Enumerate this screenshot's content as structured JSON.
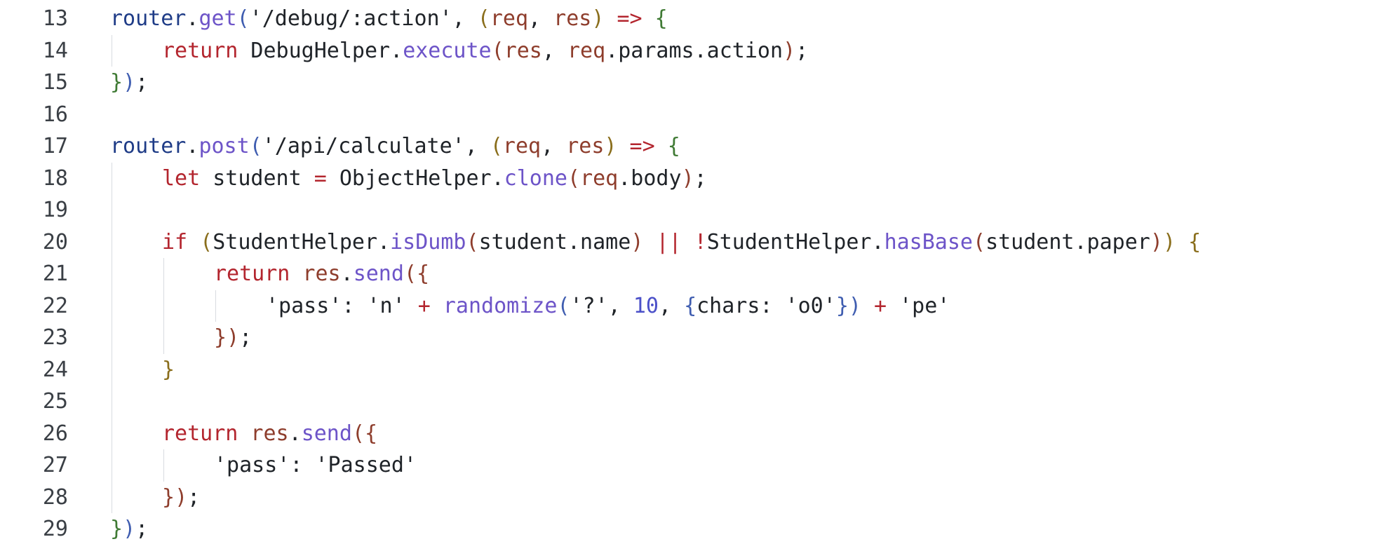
{
  "editor": {
    "lines": [
      {
        "number": "13",
        "indent": 0,
        "tokens": [
          {
            "t": "router",
            "c": "var"
          },
          {
            "t": ".",
            "c": "punc"
          },
          {
            "t": "get",
            "c": "fn"
          },
          {
            "t": "(",
            "c": "b3"
          },
          {
            "t": "'/debug/:action'",
            "c": "str"
          },
          {
            "t": ", ",
            "c": "punc"
          },
          {
            "t": "(",
            "c": "b4"
          },
          {
            "t": "req",
            "c": "param"
          },
          {
            "t": ", ",
            "c": "punc"
          },
          {
            "t": "res",
            "c": "param"
          },
          {
            "t": ")",
            "c": "b4"
          },
          {
            "t": " ",
            "c": "punc"
          },
          {
            "t": "=>",
            "c": "arrow"
          },
          {
            "t": " ",
            "c": "punc"
          },
          {
            "t": "{",
            "c": "b1"
          }
        ]
      },
      {
        "number": "14",
        "indent": 1,
        "tokens": [
          {
            "t": "return",
            "c": "kw"
          },
          {
            "t": " DebugHelper",
            "c": "id"
          },
          {
            "t": ".",
            "c": "punc"
          },
          {
            "t": "execute",
            "c": "fn"
          },
          {
            "t": "(",
            "c": "b2"
          },
          {
            "t": "res",
            "c": "param"
          },
          {
            "t": ", ",
            "c": "punc"
          },
          {
            "t": "req",
            "c": "param"
          },
          {
            "t": ".params.action",
            "c": "id"
          },
          {
            "t": ")",
            "c": "b2"
          },
          {
            "t": ";",
            "c": "punc"
          }
        ]
      },
      {
        "number": "15",
        "indent": 0,
        "tokens": [
          {
            "t": "}",
            "c": "b1"
          },
          {
            "t": ")",
            "c": "b3"
          },
          {
            "t": ";",
            "c": "punc"
          }
        ]
      },
      {
        "number": "16",
        "indent": 0,
        "tokens": []
      },
      {
        "number": "17",
        "indent": 0,
        "tokens": [
          {
            "t": "router",
            "c": "var"
          },
          {
            "t": ".",
            "c": "punc"
          },
          {
            "t": "post",
            "c": "fn"
          },
          {
            "t": "(",
            "c": "b3"
          },
          {
            "t": "'/api/calculate'",
            "c": "str"
          },
          {
            "t": ", ",
            "c": "punc"
          },
          {
            "t": "(",
            "c": "b4"
          },
          {
            "t": "req",
            "c": "param"
          },
          {
            "t": ", ",
            "c": "punc"
          },
          {
            "t": "res",
            "c": "param"
          },
          {
            "t": ")",
            "c": "b4"
          },
          {
            "t": " ",
            "c": "punc"
          },
          {
            "t": "=>",
            "c": "arrow"
          },
          {
            "t": " ",
            "c": "punc"
          },
          {
            "t": "{",
            "c": "b1"
          }
        ]
      },
      {
        "number": "18",
        "indent": 1,
        "tokens": [
          {
            "t": "let",
            "c": "kw"
          },
          {
            "t": " student ",
            "c": "id"
          },
          {
            "t": "=",
            "c": "op"
          },
          {
            "t": " ObjectHelper",
            "c": "id"
          },
          {
            "t": ".",
            "c": "punc"
          },
          {
            "t": "clone",
            "c": "fn"
          },
          {
            "t": "(",
            "c": "b2"
          },
          {
            "t": "req",
            "c": "param"
          },
          {
            "t": ".body",
            "c": "id"
          },
          {
            "t": ")",
            "c": "b2"
          },
          {
            "t": ";",
            "c": "punc"
          }
        ]
      },
      {
        "number": "19",
        "indent": 1,
        "tokens": []
      },
      {
        "number": "20",
        "indent": 1,
        "tokens": [
          {
            "t": "if",
            "c": "kw"
          },
          {
            "t": " ",
            "c": "punc"
          },
          {
            "t": "(",
            "c": "b4"
          },
          {
            "t": "StudentHelper",
            "c": "id"
          },
          {
            "t": ".",
            "c": "punc"
          },
          {
            "t": "isDumb",
            "c": "fn"
          },
          {
            "t": "(",
            "c": "b2"
          },
          {
            "t": "student.name",
            "c": "id"
          },
          {
            "t": ")",
            "c": "b2"
          },
          {
            "t": " ",
            "c": "punc"
          },
          {
            "t": "||",
            "c": "op"
          },
          {
            "t": " ",
            "c": "punc"
          },
          {
            "t": "!",
            "c": "op"
          },
          {
            "t": "StudentHelper",
            "c": "id"
          },
          {
            "t": ".",
            "c": "punc"
          },
          {
            "t": "hasBase",
            "c": "fn"
          },
          {
            "t": "(",
            "c": "b2"
          },
          {
            "t": "student.paper",
            "c": "id"
          },
          {
            "t": ")",
            "c": "b2"
          },
          {
            "t": ")",
            "c": "b4"
          },
          {
            "t": " ",
            "c": "punc"
          },
          {
            "t": "{",
            "c": "b4"
          }
        ]
      },
      {
        "number": "21",
        "indent": 2,
        "tokens": [
          {
            "t": "return",
            "c": "kw"
          },
          {
            "t": " res",
            "c": "param"
          },
          {
            "t": ".",
            "c": "punc"
          },
          {
            "t": "send",
            "c": "fn"
          },
          {
            "t": "(",
            "c": "b2"
          },
          {
            "t": "{",
            "c": "b2"
          }
        ]
      },
      {
        "number": "22",
        "indent": 3,
        "tokens": [
          {
            "t": "'pass'",
            "c": "str"
          },
          {
            "t": ": ",
            "c": "punc"
          },
          {
            "t": "'n'",
            "c": "str"
          },
          {
            "t": " ",
            "c": "punc"
          },
          {
            "t": "+",
            "c": "op"
          },
          {
            "t": " ",
            "c": "punc"
          },
          {
            "t": "randomize",
            "c": "fn"
          },
          {
            "t": "(",
            "c": "b3"
          },
          {
            "t": "'?'",
            "c": "str"
          },
          {
            "t": ", ",
            "c": "punc"
          },
          {
            "t": "10",
            "c": "num"
          },
          {
            "t": ", ",
            "c": "punc"
          },
          {
            "t": "{",
            "c": "b3"
          },
          {
            "t": "chars: ",
            "c": "id"
          },
          {
            "t": "'o0'",
            "c": "str"
          },
          {
            "t": "}",
            "c": "b3"
          },
          {
            "t": ")",
            "c": "b3"
          },
          {
            "t": " ",
            "c": "punc"
          },
          {
            "t": "+",
            "c": "op"
          },
          {
            "t": " ",
            "c": "punc"
          },
          {
            "t": "'pe'",
            "c": "str"
          }
        ]
      },
      {
        "number": "23",
        "indent": 2,
        "tokens": [
          {
            "t": "}",
            "c": "b2"
          },
          {
            "t": ")",
            "c": "b2"
          },
          {
            "t": ";",
            "c": "punc"
          }
        ]
      },
      {
        "number": "24",
        "indent": 1,
        "tokens": [
          {
            "t": "}",
            "c": "b4"
          }
        ]
      },
      {
        "number": "25",
        "indent": 1,
        "tokens": []
      },
      {
        "number": "26",
        "indent": 1,
        "tokens": [
          {
            "t": "return",
            "c": "kw"
          },
          {
            "t": " res",
            "c": "param"
          },
          {
            "t": ".",
            "c": "punc"
          },
          {
            "t": "send",
            "c": "fn"
          },
          {
            "t": "(",
            "c": "b2"
          },
          {
            "t": "{",
            "c": "b2"
          }
        ]
      },
      {
        "number": "27",
        "indent": 2,
        "tokens": [
          {
            "t": "'pass'",
            "c": "str"
          },
          {
            "t": ": ",
            "c": "punc"
          },
          {
            "t": "'Passed'",
            "c": "str"
          }
        ]
      },
      {
        "number": "28",
        "indent": 1,
        "tokens": [
          {
            "t": "}",
            "c": "b2"
          },
          {
            "t": ")",
            "c": "b2"
          },
          {
            "t": ";",
            "c": "punc"
          }
        ]
      },
      {
        "number": "29",
        "indent": 0,
        "tokens": [
          {
            "t": "}",
            "c": "b1"
          },
          {
            "t": ")",
            "c": "b3"
          },
          {
            "t": ";",
            "c": "punc"
          }
        ]
      }
    ]
  }
}
